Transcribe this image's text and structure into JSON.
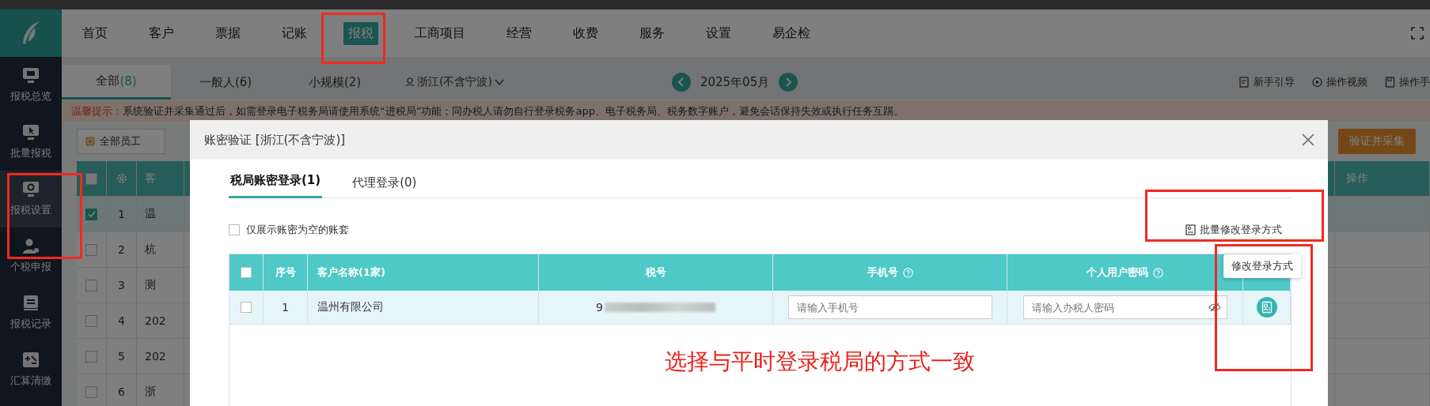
{
  "nav": {
    "items": [
      {
        "label": "首页",
        "selected": false
      },
      {
        "label": "客户",
        "selected": false
      },
      {
        "label": "票据",
        "selected": false
      },
      {
        "label": "记账",
        "selected": false
      },
      {
        "label": "报税",
        "selected": true
      },
      {
        "label": "工商项目",
        "selected": false
      },
      {
        "label": "经营",
        "selected": false
      },
      {
        "label": "收费",
        "selected": false
      },
      {
        "label": "服务",
        "selected": false
      },
      {
        "label": "设置",
        "selected": false
      },
      {
        "label": "易企检",
        "selected": false
      }
    ]
  },
  "sidebar": {
    "items": [
      {
        "label": "报税总览",
        "selected": false,
        "kind": "monitor"
      },
      {
        "label": "批量报税",
        "selected": false,
        "kind": "cursor"
      },
      {
        "label": "报税设置",
        "selected": true,
        "kind": "gear"
      },
      {
        "label": "个税申报",
        "selected": false,
        "kind": "person"
      },
      {
        "label": "报税记录",
        "selected": false,
        "kind": "record"
      },
      {
        "label": "汇算清缴",
        "selected": false,
        "kind": "calc"
      }
    ]
  },
  "tabs": [
    {
      "label": "全部",
      "count": "(8)",
      "selected": true
    },
    {
      "label": "一般人",
      "count": "(6)",
      "selected": false
    },
    {
      "label": "小规模",
      "count": "(2)",
      "selected": false
    }
  ],
  "region_select": "浙江(不含宁波)",
  "period": "2025年05月",
  "help_links": [
    {
      "label": "新手引导",
      "kind": "guide"
    },
    {
      "label": "操作视频",
      "kind": "video"
    },
    {
      "label": "操作手",
      "kind": "manual"
    }
  ],
  "notice": {
    "label": "温馨提示：",
    "text": "系统验证并采集通过后，如需登录电子税务局请使用系统“进税局”功能；同办税人请勿自行登录税务app、电子税务局、税务数字账户，避免会话保持失效或执行任务互踢。"
  },
  "toolbar": {
    "staff_filter": "全部员工",
    "verify_button": "验证并采集"
  },
  "background_table": {
    "all_checked": false,
    "name_column": "客",
    "action_column": "操作",
    "rows": [
      {
        "checked": true,
        "index": "1",
        "name": "温"
      },
      {
        "checked": false,
        "index": "2",
        "name": "杭"
      },
      {
        "checked": false,
        "index": "3",
        "name": "测"
      },
      {
        "checked": false,
        "index": "4",
        "name": "202"
      },
      {
        "checked": false,
        "index": "5",
        "name": "202"
      },
      {
        "checked": false,
        "index": "6",
        "name": "浙"
      }
    ]
  },
  "modal": {
    "title": "账密验证 [浙江(不含宁波)]",
    "tabs": [
      {
        "label": "税局账密登录(1)",
        "selected": true
      },
      {
        "label": "代理登录(0)",
        "selected": false
      }
    ],
    "filter_checkbox": {
      "label": "仅展示账密为空的账套",
      "checked": false
    },
    "batch_link": "批量修改登录方式",
    "table": {
      "all_checked": false,
      "columns": [
        {
          "label": "序号",
          "help": false
        },
        {
          "label": "客户名称(1家)",
          "help": false
        },
        {
          "label": "税号",
          "help": false
        },
        {
          "label": "手机号",
          "help": true
        },
        {
          "label": "个人用户密码",
          "help": true
        }
      ],
      "rows": [
        {
          "checked": false,
          "index": "1",
          "name": "温州有限公司",
          "tax_id": "9",
          "phone_placeholder": "请输入手机号",
          "password_placeholder": "请输入办税人密码"
        }
      ]
    },
    "tooltip": "修改登录方式"
  },
  "annotation": "选择与平时登录税局的方式一致"
}
